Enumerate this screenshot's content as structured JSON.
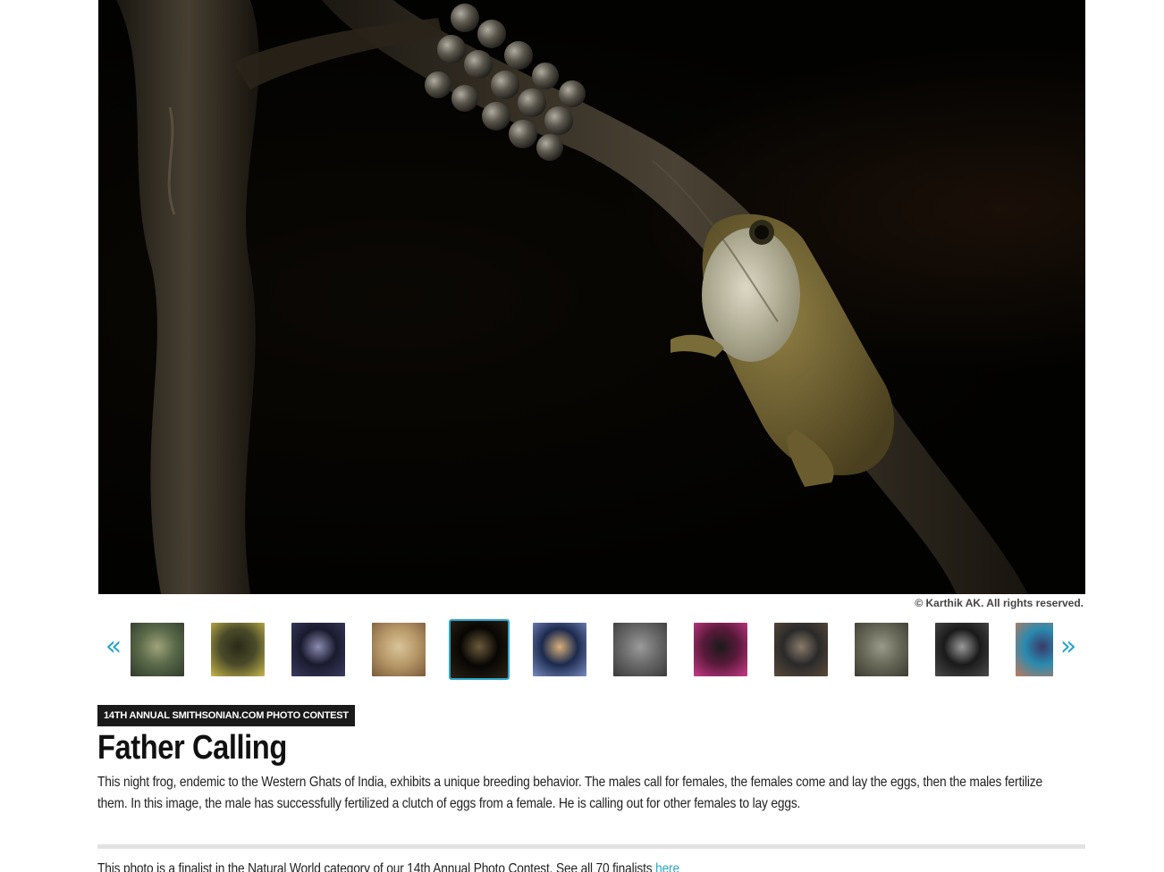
{
  "hero": {
    "alt": "Night frog calling beside a clutch of eggs on a branch",
    "credit": "© Karthik AK. All rights reserved."
  },
  "carousel": {
    "prev_symbol": "«",
    "next_symbol": "»",
    "active_index": 4,
    "thumbnails": [
      {
        "name": "thumb-crustacean",
        "colors": [
          "#5a6a4a",
          "#2f3a2a",
          "#a0a27a"
        ]
      },
      {
        "name": "thumb-snake-bird",
        "colors": [
          "#4a4a2a",
          "#c8b84a",
          "#2a2a18"
        ]
      },
      {
        "name": "thumb-lightning-sky",
        "colors": [
          "#1a1a2e",
          "#3b3c5e",
          "#8a8cb0"
        ]
      },
      {
        "name": "thumb-owl",
        "colors": [
          "#b89a6a",
          "#7a5a3a",
          "#d9c49a"
        ]
      },
      {
        "name": "thumb-night-frog",
        "colors": [
          "#080603",
          "#2a2216",
          "#6b5a3a"
        ]
      },
      {
        "name": "thumb-sunset-sea",
        "colors": [
          "#1c2a4e",
          "#7a8cc0",
          "#d9b07a"
        ]
      },
      {
        "name": "thumb-elephant",
        "colors": [
          "#6a6a6a",
          "#3a3a3a",
          "#9a9a9a"
        ]
      },
      {
        "name": "thumb-pink-flower",
        "colors": [
          "#5a1a3a",
          "#c83a8a",
          "#1a1a1a"
        ]
      },
      {
        "name": "thumb-horse-rider",
        "colors": [
          "#2a2a2a",
          "#5a4a3a",
          "#8a7a6a"
        ]
      },
      {
        "name": "thumb-raccoon",
        "colors": [
          "#6a6a5a",
          "#3a3a30",
          "#9a9a8a"
        ]
      },
      {
        "name": "thumb-night-street",
        "colors": [
          "#1a1a1a",
          "#4a4a4a",
          "#9a9a9a"
        ]
      },
      {
        "name": "thumb-child-portrait",
        "colors": [
          "#2a8ab0",
          "#c07a5a",
          "#3a3a6a"
        ]
      }
    ]
  },
  "article": {
    "tag": "14TH ANNUAL SMITHSONIAN.COM PHOTO CONTEST",
    "title": "Father Calling",
    "description": "This night frog, endemic to the Western Ghats of India, exhibits a unique breeding behavior. The males call for females, the females come and lay the eggs, then the males fertilize them. In this image, the male has successfully fertilized a clutch of eggs from a female. He is calling out for other females to lay eggs.",
    "footer_text": "This photo is a finalist in the Natural World category of our 14th Annual Photo Contest. See all 70 finalists ",
    "footer_link": "here"
  },
  "colors": {
    "accent": "#2ba6cb",
    "tag_bg": "#1a1a1a"
  }
}
